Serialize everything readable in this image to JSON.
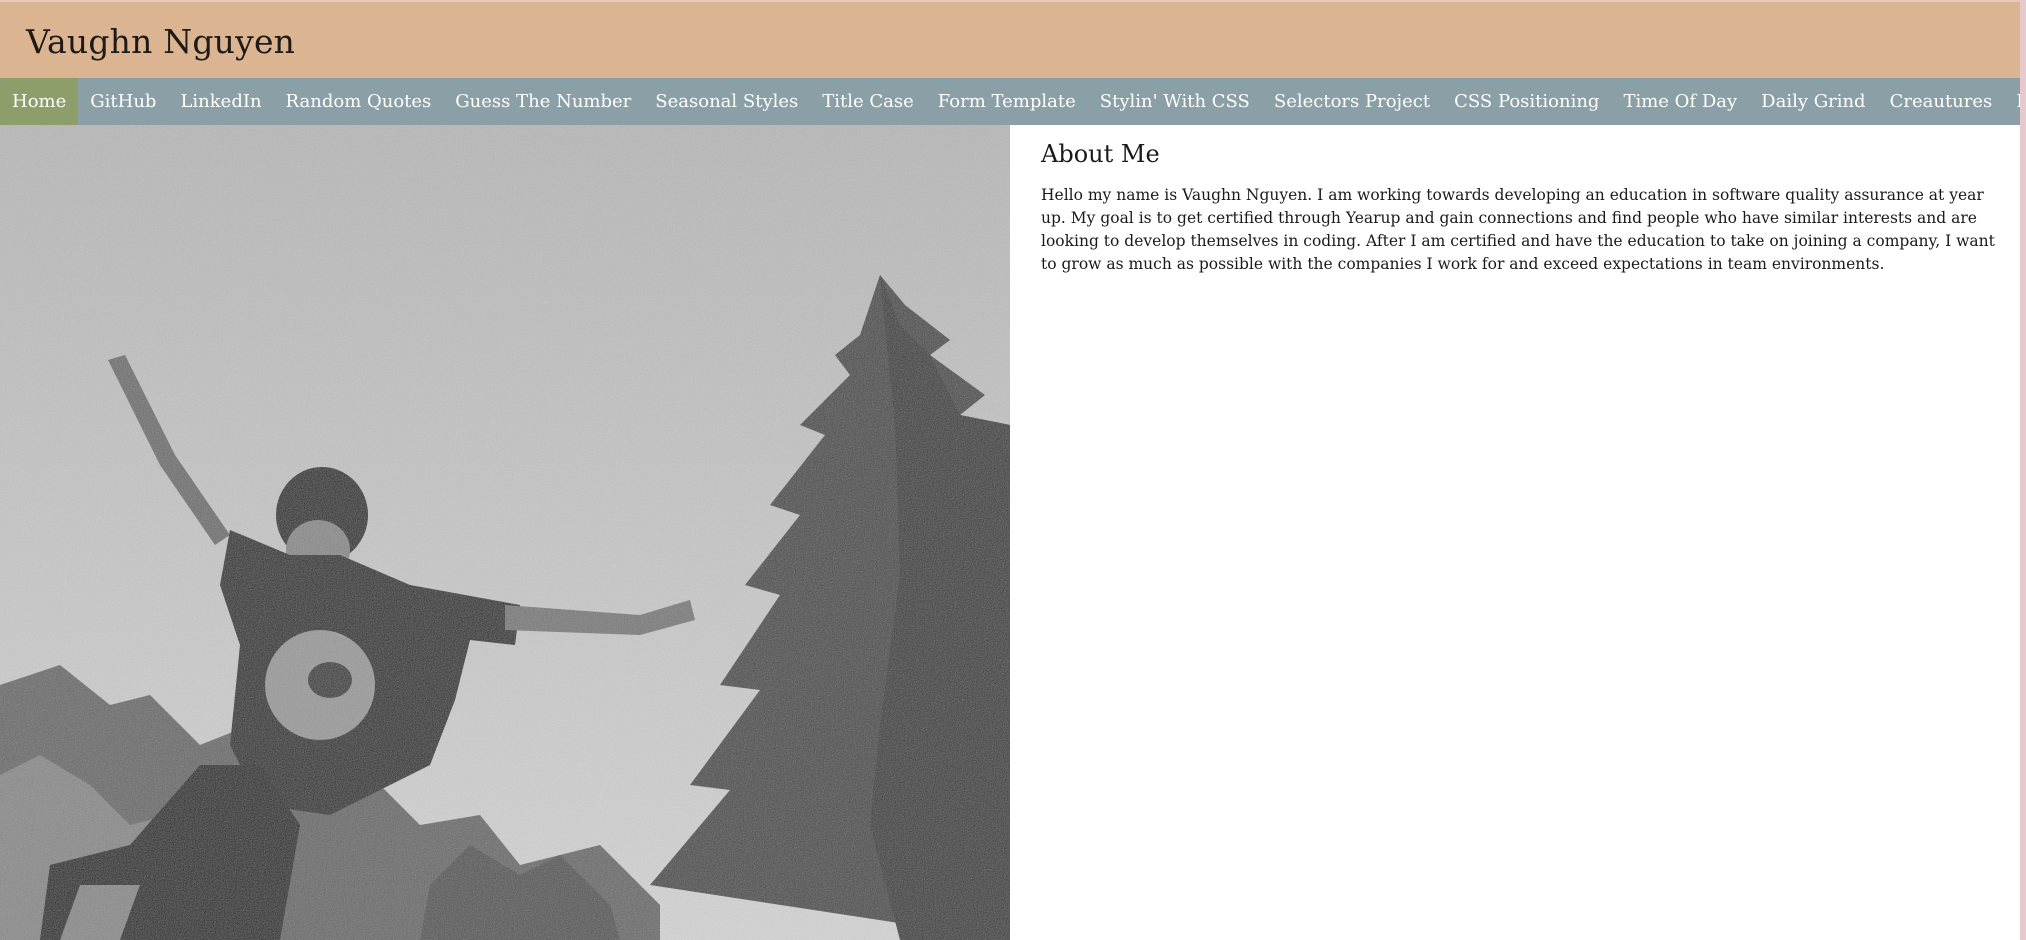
{
  "header": {
    "title": "Vaughn Nguyen"
  },
  "nav": {
    "items": [
      {
        "label": "Home",
        "active": true
      },
      {
        "label": "GitHub"
      },
      {
        "label": "LinkedIn"
      },
      {
        "label": "Random Quotes"
      },
      {
        "label": "Guess The Number"
      },
      {
        "label": "Seasonal Styles"
      },
      {
        "label": "Title Case"
      },
      {
        "label": "Form Template"
      },
      {
        "label": "Stylin' With CSS"
      },
      {
        "label": "Selectors Project"
      },
      {
        "label": "CSS Positioning"
      },
      {
        "label": "Time Of Day"
      },
      {
        "label": "Daily Grind"
      },
      {
        "label": "Creautures"
      },
      {
        "label": "Dom Play"
      }
    ]
  },
  "about": {
    "heading": "About Me",
    "body": "Hello my name is Vaughn Nguyen. I am working towards developing an education in software quality assurance at year up. My goal is to get certified through Yearup and gain connections and find people who have similar interests and are looking to develop themselves in coding. After I am certified and have the education to take on joining a company, I want to grow as much as possible with the companies I work for and exceed expectations in team environments."
  },
  "colors": {
    "header_bg": "#dbb592",
    "nav_bg": "#8a9fa6",
    "nav_active_bg": "#8e9e6b",
    "page_bg": "#ffffff"
  }
}
